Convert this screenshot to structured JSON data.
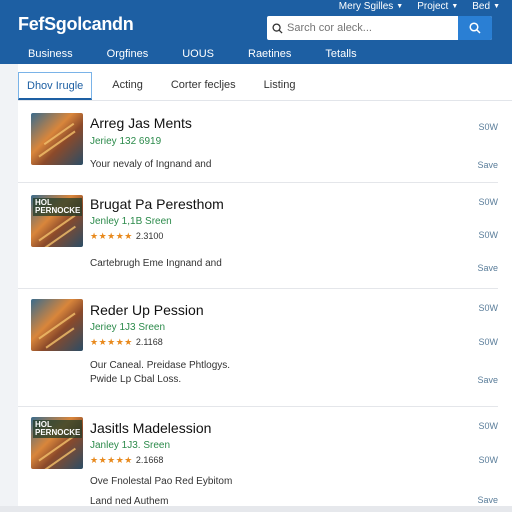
{
  "header": {
    "logo": "FefSgolcandn",
    "top_links": [
      {
        "label": "Mery Sgilles"
      },
      {
        "label": "Project"
      },
      {
        "label": "Bed"
      }
    ],
    "search_placeholder": "Sarch cor aleck...",
    "nav": [
      "Business",
      "Orgfines",
      "UOUS",
      "Raetines",
      "Tetalls"
    ],
    "bg_color": "#1d5fa3"
  },
  "tabs": [
    "Dhov Irugle",
    "Acting",
    "Corter fecljes",
    "Listing"
  ],
  "active_tab": 0,
  "items": [
    {
      "title": "Arreg Jas Ments",
      "subtitle": "Jeriey 132 6919",
      "rating_text": "",
      "stars": "",
      "thumb_text": "",
      "desc": [
        "Your nevaly of Ingnand and"
      ],
      "actions": [
        "S0W",
        "Save"
      ]
    },
    {
      "title": "Brugat Pa Peresthom",
      "subtitle": "Jenley 1,1B Sreen",
      "stars": "★★★★★",
      "rating_text": "2.3100",
      "thumb_text": "HOL\nPERNOCKE",
      "desc": [
        "Cartebrugh Eme Ingnand and"
      ],
      "actions": [
        "S0W",
        "S0W",
        "Save"
      ]
    },
    {
      "title": "Reder Up Pession",
      "subtitle": "Jeriey 1J3 Sreen",
      "stars": "★★★★★",
      "rating_text": "2.1168",
      "thumb_text": "",
      "desc": [
        "Our Caneal. Preidase Phtlogys.",
        "Pwide Lp Cbal Loss."
      ],
      "actions": [
        "S0W",
        "S0W",
        "Save"
      ]
    },
    {
      "title": "Jasitls Madelession",
      "subtitle": "Janley 1J3. Sreen",
      "stars": "★★★★★",
      "rating_text": "2.1668",
      "thumb_text": "HOL\nPERNOCKE",
      "desc": [
        "Ove Fnolestal Pao Red Eybitom",
        "Land ned Authem"
      ],
      "actions": [
        "S0W",
        "S0W",
        "Save"
      ]
    }
  ]
}
